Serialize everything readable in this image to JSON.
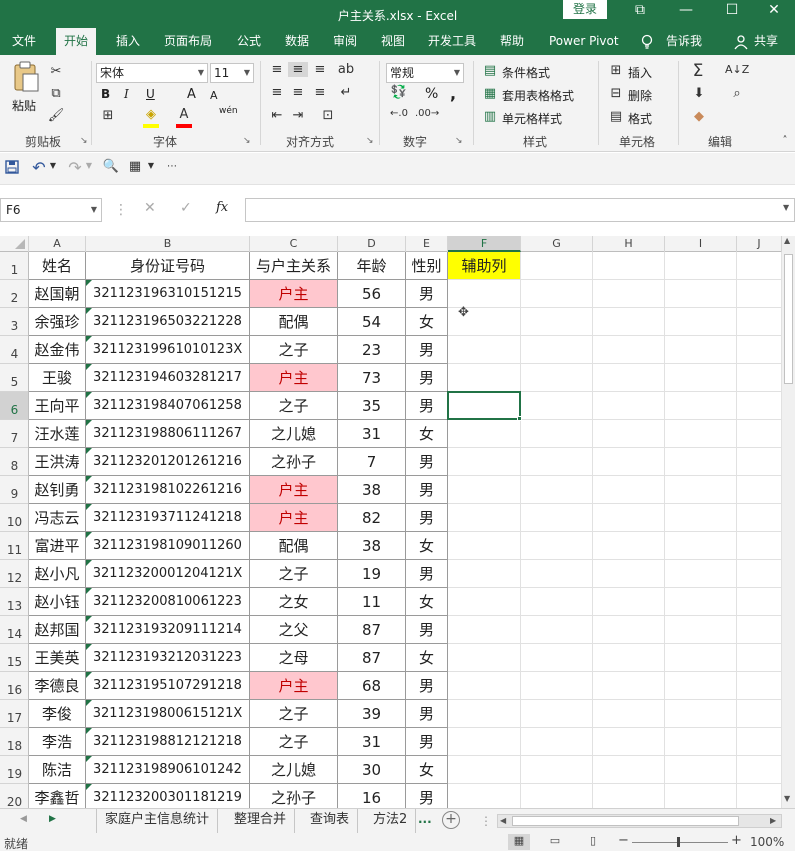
{
  "window": {
    "title": "户主关系.xlsx  -  Excel",
    "login_label": "登录",
    "controls": {
      "ribbon_options": "⧉",
      "minimize": "—",
      "maximize": "☐",
      "close": "✕"
    }
  },
  "tabs": [
    {
      "label": "文件"
    },
    {
      "label": "开始"
    },
    {
      "label": "插入"
    },
    {
      "label": "页面布局"
    },
    {
      "label": "公式"
    },
    {
      "label": "数据"
    },
    {
      "label": "审阅"
    },
    {
      "label": "视图"
    },
    {
      "label": "开发工具"
    },
    {
      "label": "帮助"
    },
    {
      "label": "Power Pivot"
    }
  ],
  "tellme": "告诉我",
  "share": "共享",
  "ribbon": {
    "clipboard": {
      "paste": "粘贴",
      "label": "剪贴板"
    },
    "font": {
      "name": "宋体",
      "size": "11",
      "label": "字体",
      "bold": "B",
      "italic": "I",
      "underline": "U",
      "grow": "A",
      "shrink": "A",
      "phonetic": "wén"
    },
    "alignment": {
      "label": "对齐方式"
    },
    "number": {
      "format": "常规",
      "label": "数字",
      "percent": "%",
      "comma": ","
    },
    "styles": {
      "conditional": "条件格式",
      "table": "套用表格格式",
      "cell": "单元格样式",
      "label": "样式"
    },
    "cells": {
      "insert": "插入",
      "delete": "删除",
      "format": "格式",
      "label": "单元格"
    },
    "editing": {
      "label": "编辑"
    }
  },
  "icons": {
    "cut": "scissors-icon",
    "copy": "copy-icon",
    "painter": "format-painter-icon",
    "save": "save-icon",
    "undo": "undo-icon",
    "redo": "redo-icon",
    "print_preview": "print-preview-icon",
    "lightbulb": "lightbulb-icon",
    "person": "person-icon"
  },
  "formula_bar": {
    "name_box": "F6",
    "fx": "fx",
    "cancel": "✕",
    "confirm": "✓",
    "value": ""
  },
  "columns": [
    "A",
    "B",
    "C",
    "D",
    "E",
    "F",
    "G",
    "H",
    "I",
    "J"
  ],
  "selected_column": "F",
  "selected_row": "6",
  "header_row": {
    "number": "1",
    "cells": [
      "姓名",
      "身份证号码",
      "与户主关系",
      "年龄",
      "性别",
      "辅助列"
    ]
  },
  "rows": [
    {
      "n": "2",
      "name": "赵国朝",
      "id": "321123196310151215",
      "rel": "户主",
      "age": "56",
      "sex": "男",
      "hl": true
    },
    {
      "n": "3",
      "name": "余强珍",
      "id": "321123196503221228",
      "rel": "配偶",
      "age": "54",
      "sex": "女",
      "hl": false
    },
    {
      "n": "4",
      "name": "赵金伟",
      "id": "32112319961010123X",
      "rel": "之子",
      "age": "23",
      "sex": "男",
      "hl": false
    },
    {
      "n": "5",
      "name": "王骏",
      "id": "321123194603281217",
      "rel": "户主",
      "age": "73",
      "sex": "男",
      "hl": true
    },
    {
      "n": "6",
      "name": "王向平",
      "id": "321123198407061258",
      "rel": "之子",
      "age": "35",
      "sex": "男",
      "hl": false
    },
    {
      "n": "7",
      "name": "汪水莲",
      "id": "321123198806111267",
      "rel": "之儿媳",
      "age": "31",
      "sex": "女",
      "hl": false
    },
    {
      "n": "8",
      "name": "王洪涛",
      "id": "321123201201261216",
      "rel": "之孙子",
      "age": "7",
      "sex": "男",
      "hl": false
    },
    {
      "n": "9",
      "name": "赵钊勇",
      "id": "321123198102261216",
      "rel": "户主",
      "age": "38",
      "sex": "男",
      "hl": true
    },
    {
      "n": "10",
      "name": "冯志云",
      "id": "321123193711241218",
      "rel": "户主",
      "age": "82",
      "sex": "男",
      "hl": true
    },
    {
      "n": "11",
      "name": "富进平",
      "id": "321123198109011260",
      "rel": "配偶",
      "age": "38",
      "sex": "女",
      "hl": false
    },
    {
      "n": "12",
      "name": "赵小凡",
      "id": "32112320001204121X",
      "rel": "之子",
      "age": "19",
      "sex": "男",
      "hl": false
    },
    {
      "n": "13",
      "name": "赵小钰",
      "id": "321123200810061223",
      "rel": "之女",
      "age": "11",
      "sex": "女",
      "hl": false
    },
    {
      "n": "14",
      "name": "赵邦国",
      "id": "321123193209111214",
      "rel": "之父",
      "age": "87",
      "sex": "男",
      "hl": false
    },
    {
      "n": "15",
      "name": "王美英",
      "id": "321123193212031223",
      "rel": "之母",
      "age": "87",
      "sex": "女",
      "hl": false
    },
    {
      "n": "16",
      "name": "李德良",
      "id": "321123195107291218",
      "rel": "户主",
      "age": "68",
      "sex": "男",
      "hl": true
    },
    {
      "n": "17",
      "name": "李俊",
      "id": "32112319800615121X",
      "rel": "之子",
      "age": "39",
      "sex": "男",
      "hl": false
    },
    {
      "n": "18",
      "name": "李浩",
      "id": "321123198812121218",
      "rel": "之子",
      "age": "31",
      "sex": "男",
      "hl": false
    },
    {
      "n": "19",
      "name": "陈洁",
      "id": "321123198906101242",
      "rel": "之儿媳",
      "age": "30",
      "sex": "女",
      "hl": false
    },
    {
      "n": "20",
      "name": "李鑫哲",
      "id": "321123200301181219",
      "rel": "之孙子",
      "age": "16",
      "sex": "男",
      "hl": false
    }
  ],
  "sheet_tabs": [
    "家庭户主信息统计",
    "整理合并",
    "查询表",
    "方法2"
  ],
  "sheet_more": "...",
  "status": {
    "ready": "就绪",
    "zoom": "100%",
    "minus": "−",
    "plus": "+"
  },
  "colors": {
    "accent": "#217346",
    "highlight_fill": "#ffc7ce",
    "highlight_text": "#c00000",
    "helper_fill": "#ffff00"
  }
}
